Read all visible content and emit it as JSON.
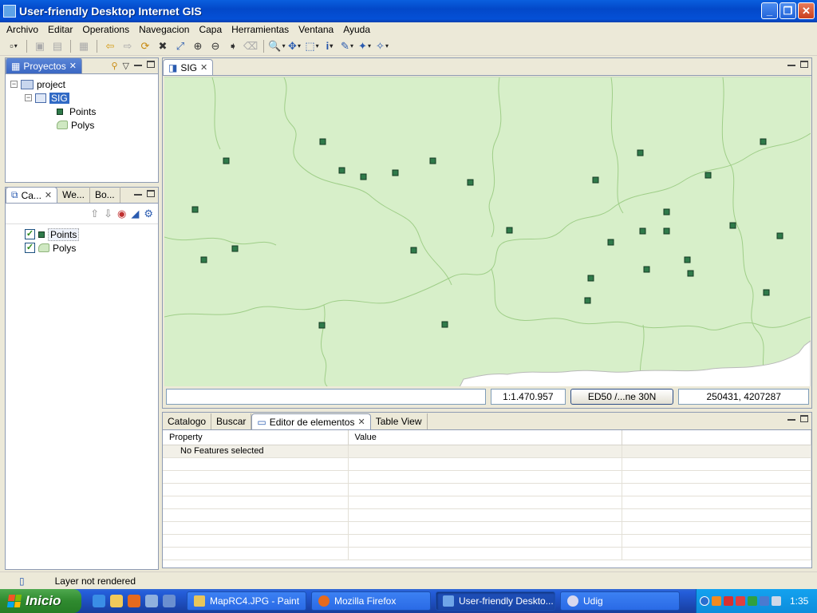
{
  "window": {
    "title": "User-friendly Desktop Internet GIS",
    "minimize": "_",
    "restore": "❐",
    "close": "✕"
  },
  "menu": [
    "Archivo",
    "Editar",
    "Operations",
    "Navegacion",
    "Capa",
    "Herramientas",
    "Ventana",
    "Ayuda"
  ],
  "projects_panel": {
    "tab_label": "Proyectos",
    "tree": {
      "root": "project",
      "map": "SIG",
      "layers": [
        "Points",
        "Polys"
      ]
    }
  },
  "layers_panel": {
    "tabs": [
      "Ca...",
      "We...",
      "Bo..."
    ],
    "layers": [
      {
        "name": "Points",
        "checked": true
      },
      {
        "name": "Polys",
        "checked": true
      }
    ]
  },
  "map_editor": {
    "tab_label": "SIG",
    "scale": "1:1.470.957",
    "crs_button": "ED50 /...ne 30N",
    "coordinates": "250431, 4207287"
  },
  "bottom_panel": {
    "tabs": [
      "Catalogo",
      "Buscar",
      "Editor de elementos",
      "Table View"
    ],
    "active_tab": "Editor de elementos",
    "columns": [
      "Property",
      "Value",
      ""
    ],
    "message": "No Features selected"
  },
  "status": {
    "message": "Layer not rendered"
  },
  "taskbar": {
    "start_label": "Inicio",
    "tasks": [
      "MapRC4.JPG - Paint",
      "Mozilla Firefox",
      "User-friendly Deskto...",
      "Udig"
    ],
    "clock": "1:35"
  },
  "colors": {
    "map_fill": "#d7efc9",
    "point_fill": "#2f7a4a",
    "border_line": "#9fce88",
    "sea": "#ffffff"
  }
}
